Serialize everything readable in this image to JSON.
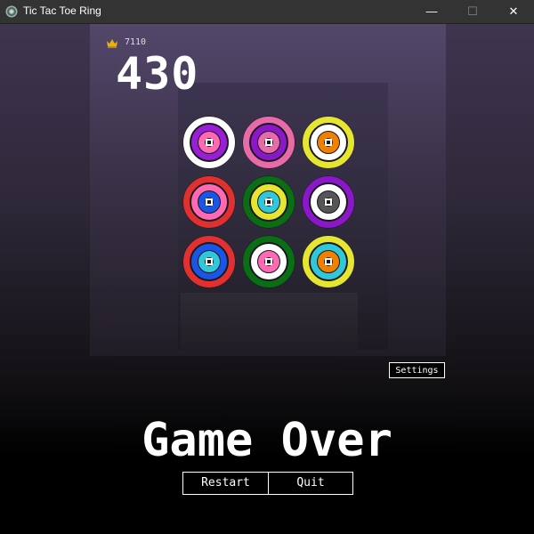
{
  "window": {
    "title": "Tic Tac Toe Ring",
    "minimize_glyph": "—",
    "maximize_glyph": "☐",
    "close_glyph": "✕"
  },
  "hud": {
    "high_score": "7110",
    "score": "430"
  },
  "board": {
    "cells": [
      {
        "rings": [
          "#ffffff",
          "#9a1ed8",
          "#ff69b4",
          "#ffffff"
        ]
      },
      {
        "rings": [
          "#e86aa8",
          "#8a18c8",
          "#e86aa8",
          "#ffffff"
        ]
      },
      {
        "rings": [
          "#e6e630",
          "#ffffff",
          "#f08000",
          "#ffffff"
        ]
      },
      {
        "rings": [
          "#e03030",
          "#ff69b4",
          "#1a55e8",
          "#ffffff"
        ]
      },
      {
        "rings": [
          "#0a6e14",
          "#e6e630",
          "#30c8d8",
          "#ffffff"
        ]
      },
      {
        "rings": [
          "#8a18c8",
          "#ffffff",
          "#555555",
          "#ffffff"
        ]
      },
      {
        "rings": [
          "#e03030",
          "#1a55e8",
          "#30c8d8",
          "#ffffff"
        ]
      },
      {
        "rings": [
          "#0a6e14",
          "#ffffff",
          "#ff69b4",
          "#ffffff"
        ]
      },
      {
        "rings": [
          "#e6e630",
          "#30c8d8",
          "#f08000",
          "#ffffff"
        ]
      }
    ]
  },
  "controls": {
    "settings_label": "Settings",
    "restart_label": "Restart",
    "quit_label": "Quit"
  },
  "status": {
    "game_over": "Game Over"
  }
}
